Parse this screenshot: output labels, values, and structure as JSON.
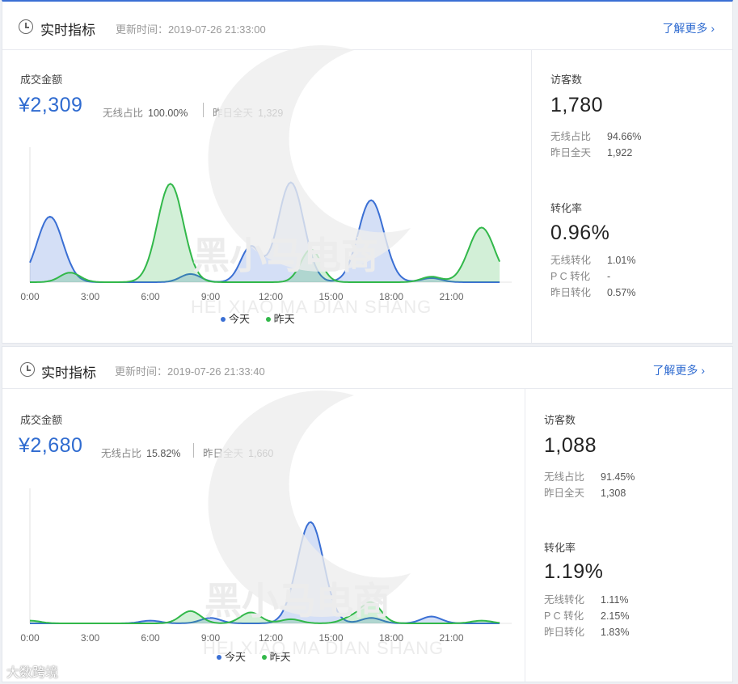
{
  "panels": [
    {
      "title": "实时指标",
      "update_time": "更新时间：2019-07-26 21:33:00",
      "more_label": "了解更多 ›",
      "sales_label": "成交金额",
      "sales_value": "¥2,309",
      "wireless_label": "无线占比",
      "wireless_value": "100.00%",
      "yesterday_label": "昨日全天",
      "yesterday_value": "1,329",
      "visitors_label": "访客数",
      "visitors_value": "1,780",
      "visitors_wireless_label": "无线占比",
      "visitors_wireless_value": "94.66%",
      "visitors_yesterday_label": "昨日全天",
      "visitors_yesterday_value": "1,922",
      "conversion_label": "转化率",
      "conversion_value": "0.96%",
      "conv_wireless_label": "无线转化",
      "conv_wireless_value": "1.01%",
      "conv_pc_label": "P C 转化",
      "conv_pc_value": "-",
      "conv_yesterday_label": "昨日转化",
      "conv_yesterday_value": "0.57%",
      "legend_today": "今天",
      "legend_yesterday": "昨天"
    },
    {
      "title": "实时指标",
      "update_time": "更新时间：2019-07-26 21:33:40",
      "more_label": "了解更多 ›",
      "sales_label": "成交金额",
      "sales_value": "¥2,680",
      "wireless_label": "无线占比",
      "wireless_value": "15.82%",
      "yesterday_label": "昨日全天",
      "yesterday_value": "1,660",
      "visitors_label": "访客数",
      "visitors_value": "1,088",
      "visitors_wireless_label": "无线占比",
      "visitors_wireless_value": "91.45%",
      "visitors_yesterday_label": "昨日全天",
      "visitors_yesterday_value": "1,308",
      "conversion_label": "转化率",
      "conversion_value": "1.19%",
      "conv_wireless_label": "无线转化",
      "conv_wireless_value": "1.11%",
      "conv_pc_label": "P C 转化",
      "conv_pc_value": "2.15%",
      "conv_yesterday_label": "昨日转化",
      "conv_yesterday_value": "1.83%",
      "legend_today": "今天",
      "legend_yesterday": "昨天"
    }
  ],
  "watermark": {
    "line1": "黑小马电商",
    "line2": "HEI XIAO MA DIAN SHANG"
  },
  "footer_mark": "大数跨境",
  "colors": {
    "accent": "#2f6bd0",
    "today": "#3a6fd4",
    "yesterday": "#32b84a"
  },
  "chart_data": [
    {
      "type": "area",
      "x_ticks": [
        "0:00",
        "3:00",
        "6:00",
        "9:00",
        "12:00",
        "15:00",
        "18:00",
        "21:00"
      ],
      "series": [
        {
          "name": "今天",
          "peaks": [
            [
              1.0,
              0.48
            ],
            [
              8.0,
              0.06
            ],
            [
              11.0,
              0.26
            ],
            [
              13.0,
              0.73
            ],
            [
              17.0,
              0.6
            ],
            [
              20.0,
              0.03
            ]
          ]
        },
        {
          "name": "昨天",
          "peaks": [
            [
              2.0,
              0.07
            ],
            [
              7.0,
              0.72
            ],
            [
              14.0,
              0.24
            ],
            [
              20.0,
              0.04
            ],
            [
              22.5,
              0.4
            ]
          ]
        }
      ],
      "grid": false,
      "legend": "bottom"
    },
    {
      "type": "area",
      "x_ticks": [
        "0:00",
        "3:00",
        "6:00",
        "9:00",
        "12:00",
        "15:00",
        "18:00",
        "21:00"
      ],
      "series": [
        {
          "name": "今天",
          "peaks": [
            [
              6.0,
              0.02
            ],
            [
              9.0,
              0.04
            ],
            [
              13.2,
              0.04
            ],
            [
              14.0,
              0.73
            ],
            [
              17.0,
              0.04
            ],
            [
              20.0,
              0.05
            ]
          ]
        },
        {
          "name": "昨天",
          "peaks": [
            [
              0.0,
              0.02
            ],
            [
              8.0,
              0.09
            ],
            [
              11.0,
              0.08
            ],
            [
              13.0,
              0.03
            ],
            [
              16.0,
              0.04
            ],
            [
              17.0,
              0.15
            ],
            [
              22.5,
              0.02
            ]
          ]
        }
      ],
      "grid": false,
      "legend": "bottom"
    }
  ]
}
